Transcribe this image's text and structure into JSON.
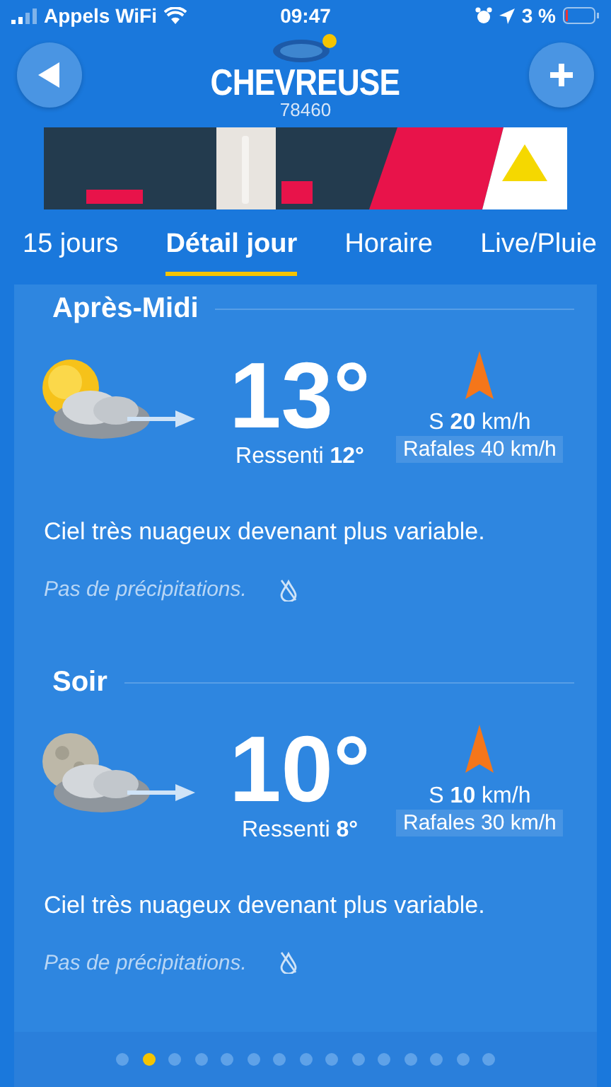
{
  "status_bar": {
    "carrier": "Appels WiFi",
    "time": "09:47",
    "battery": "3 %"
  },
  "header": {
    "city": "CHEVREUSE",
    "postcode": "78460"
  },
  "tabs": [
    {
      "label": "15 jours",
      "selected": false
    },
    {
      "label": "Détail jour",
      "selected": true
    },
    {
      "label": "Horaire",
      "selected": false
    },
    {
      "label": "Live/Pluie",
      "selected": false
    }
  ],
  "periods": [
    {
      "title": "Après-Midi",
      "kind": "sun",
      "temperature": "13°",
      "feels_like": "Ressenti **12°**",
      "wind": "S **20** km/h",
      "gusts": "Rafales 40 km/h",
      "description": "Ciel très nuageux devenant plus variable.",
      "precipitation": "Pas de précipitations."
    },
    {
      "title": "Soir",
      "kind": "moon",
      "temperature": "10°",
      "feels_like": "Ressenti **8°**",
      "wind": "S **10** km/h",
      "gusts": "Rafales 30 km/h",
      "description": "Ciel très nuageux devenant plus variable.",
      "precipitation": "Pas de précipitations."
    }
  ],
  "pager": [
    {
      "selected": false
    },
    {
      "selected": true
    },
    {
      "selected": false
    },
    {
      "selected": false
    },
    {
      "selected": false
    },
    {
      "selected": false
    },
    {
      "selected": false
    },
    {
      "selected": false
    },
    {
      "selected": false
    },
    {
      "selected": false
    },
    {
      "selected": false
    },
    {
      "selected": false
    },
    {
      "selected": false
    },
    {
      "selected": false
    },
    {
      "selected": false
    }
  ]
}
